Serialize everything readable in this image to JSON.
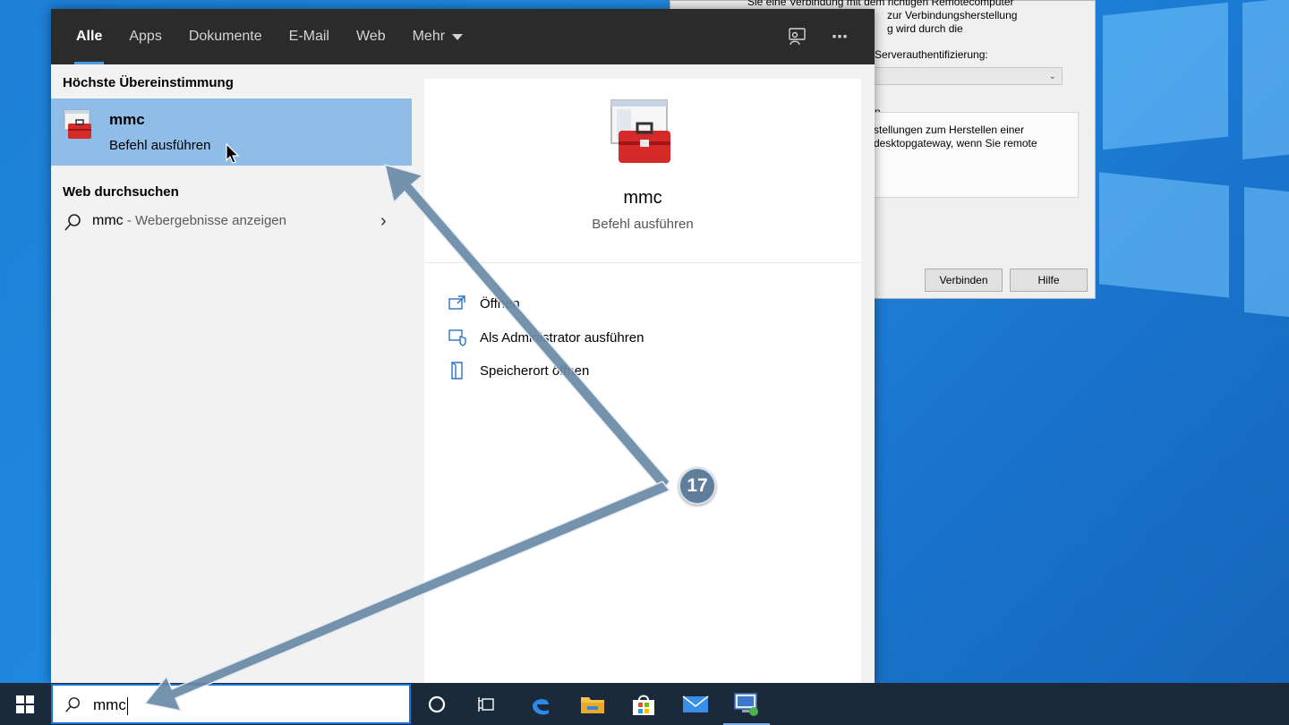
{
  "rdp_dialog": {
    "line1": "Sie eine Verbindung mit dem richtigen Remotecomputer",
    "line2": "zur Verbindungsherstellung",
    "line3": "g wird durch die",
    "server_auth_label": "Serverauthentifizierung:",
    "group_title": "n",
    "group_line1": "stellungen zum Herstellen einer",
    "group_line2": "desktopgateway, wenn Sie remote",
    "connect_label": "Verbinden",
    "help_label": "Hilfe"
  },
  "tabs": [
    {
      "label": "Alle",
      "active": true
    },
    {
      "label": "Apps"
    },
    {
      "label": "Dokumente"
    },
    {
      "label": "E-Mail"
    },
    {
      "label": "Web"
    },
    {
      "label": "Mehr"
    }
  ],
  "top_icons": {
    "feedback": "feedback-icon",
    "more": "⋯"
  },
  "best_match": {
    "heading": "Höchste Übereinstimmung",
    "title": "mmc",
    "subtitle": "Befehl ausführen"
  },
  "web_search": {
    "heading": "Web durchsuchen",
    "query": "mmc",
    "hint": " - Webergebnisse anzeigen"
  },
  "preview": {
    "name": "mmc",
    "description": "Befehl ausführen",
    "actions": [
      {
        "label": "Öffnen",
        "icon": "open-icon"
      },
      {
        "label": "Als Administrator ausführen",
        "icon": "admin-shield-icon"
      },
      {
        "label": "Speicherort öffnen",
        "icon": "file-location-icon"
      }
    ]
  },
  "taskbar": {
    "search_value": "mmc",
    "icons": [
      "cortana-icon",
      "task-view-icon",
      "edge-icon",
      "file-explorer-icon",
      "store-icon",
      "mail-icon",
      "remote-desktop-icon"
    ]
  },
  "annotation": {
    "step_number": "17"
  },
  "colors": {
    "topbar": "#2b2b2b",
    "selection": "#8fbde8",
    "accent": "#4a9be6",
    "arrow": "#6b8aa8",
    "taskbar": "#1b2a3a"
  }
}
